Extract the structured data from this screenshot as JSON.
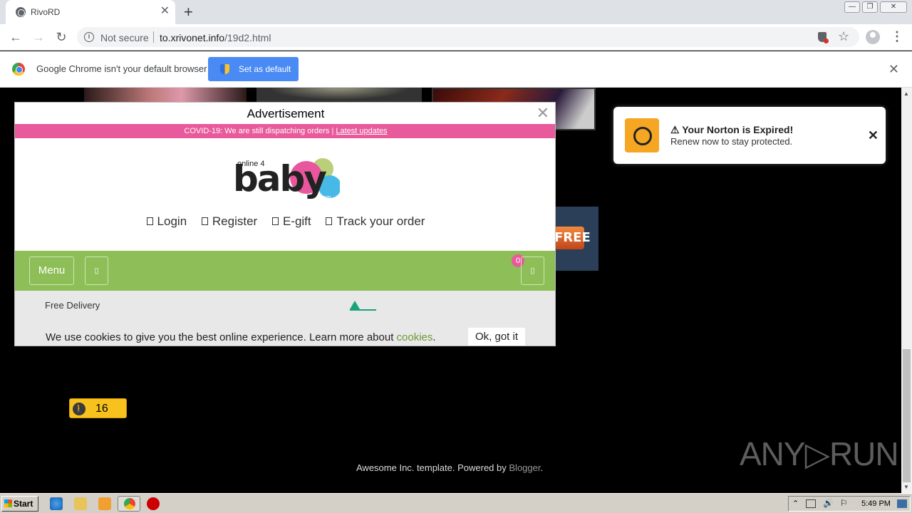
{
  "browser": {
    "tab_title": "RivoRD",
    "tab_close": "✕",
    "new_tab": "+",
    "window_buttons": [
      "—",
      "❐",
      "✕"
    ],
    "security_label": "Not secure",
    "url_host": "to.xrivonet.info",
    "url_path": "/19d2.html",
    "infobar": {
      "message": "Google Chrome isn't your default browser",
      "button": "Set as default",
      "close": "✕"
    }
  },
  "ad": {
    "title": "Advertisement",
    "close": "✕",
    "covid_text": "COVID-19: We are still dispatching orders |",
    "covid_link": "Latest updates",
    "logo_small": "online 4",
    "logo_main": "baby",
    "logo_dotcom": ".com",
    "account_links": [
      "Login",
      "Register",
      "E-gift",
      "Track your order"
    ],
    "menu_label": "Menu",
    "cart_count": "0",
    "icon_glyph": "▯",
    "free_delivery": "Free Delivery",
    "cookie_text": "We use cookies to give you the best online experience. Learn more about",
    "cookie_link": "cookies",
    "cookie_ok": "Ok, got it"
  },
  "norton": {
    "title": "⚠ Your Norton is Expired!",
    "subtitle": "Renew now to stay protected.",
    "close": "✕"
  },
  "page": {
    "promo_label": "FREE",
    "counter_value": "16",
    "footer_text": "Awesome Inc. template. Powered by",
    "footer_link": "Blogger",
    "footer_end": ".",
    "watermark": "ANY▷RUN"
  },
  "taskbar": {
    "start": "Start",
    "clock": "5:49 PM"
  },
  "colors": {
    "covid_bar": "#e85a9b",
    "nav_bar": "#8ebe57",
    "chrome_button": "#4a8af4",
    "norton_icon": "#f5a623"
  }
}
